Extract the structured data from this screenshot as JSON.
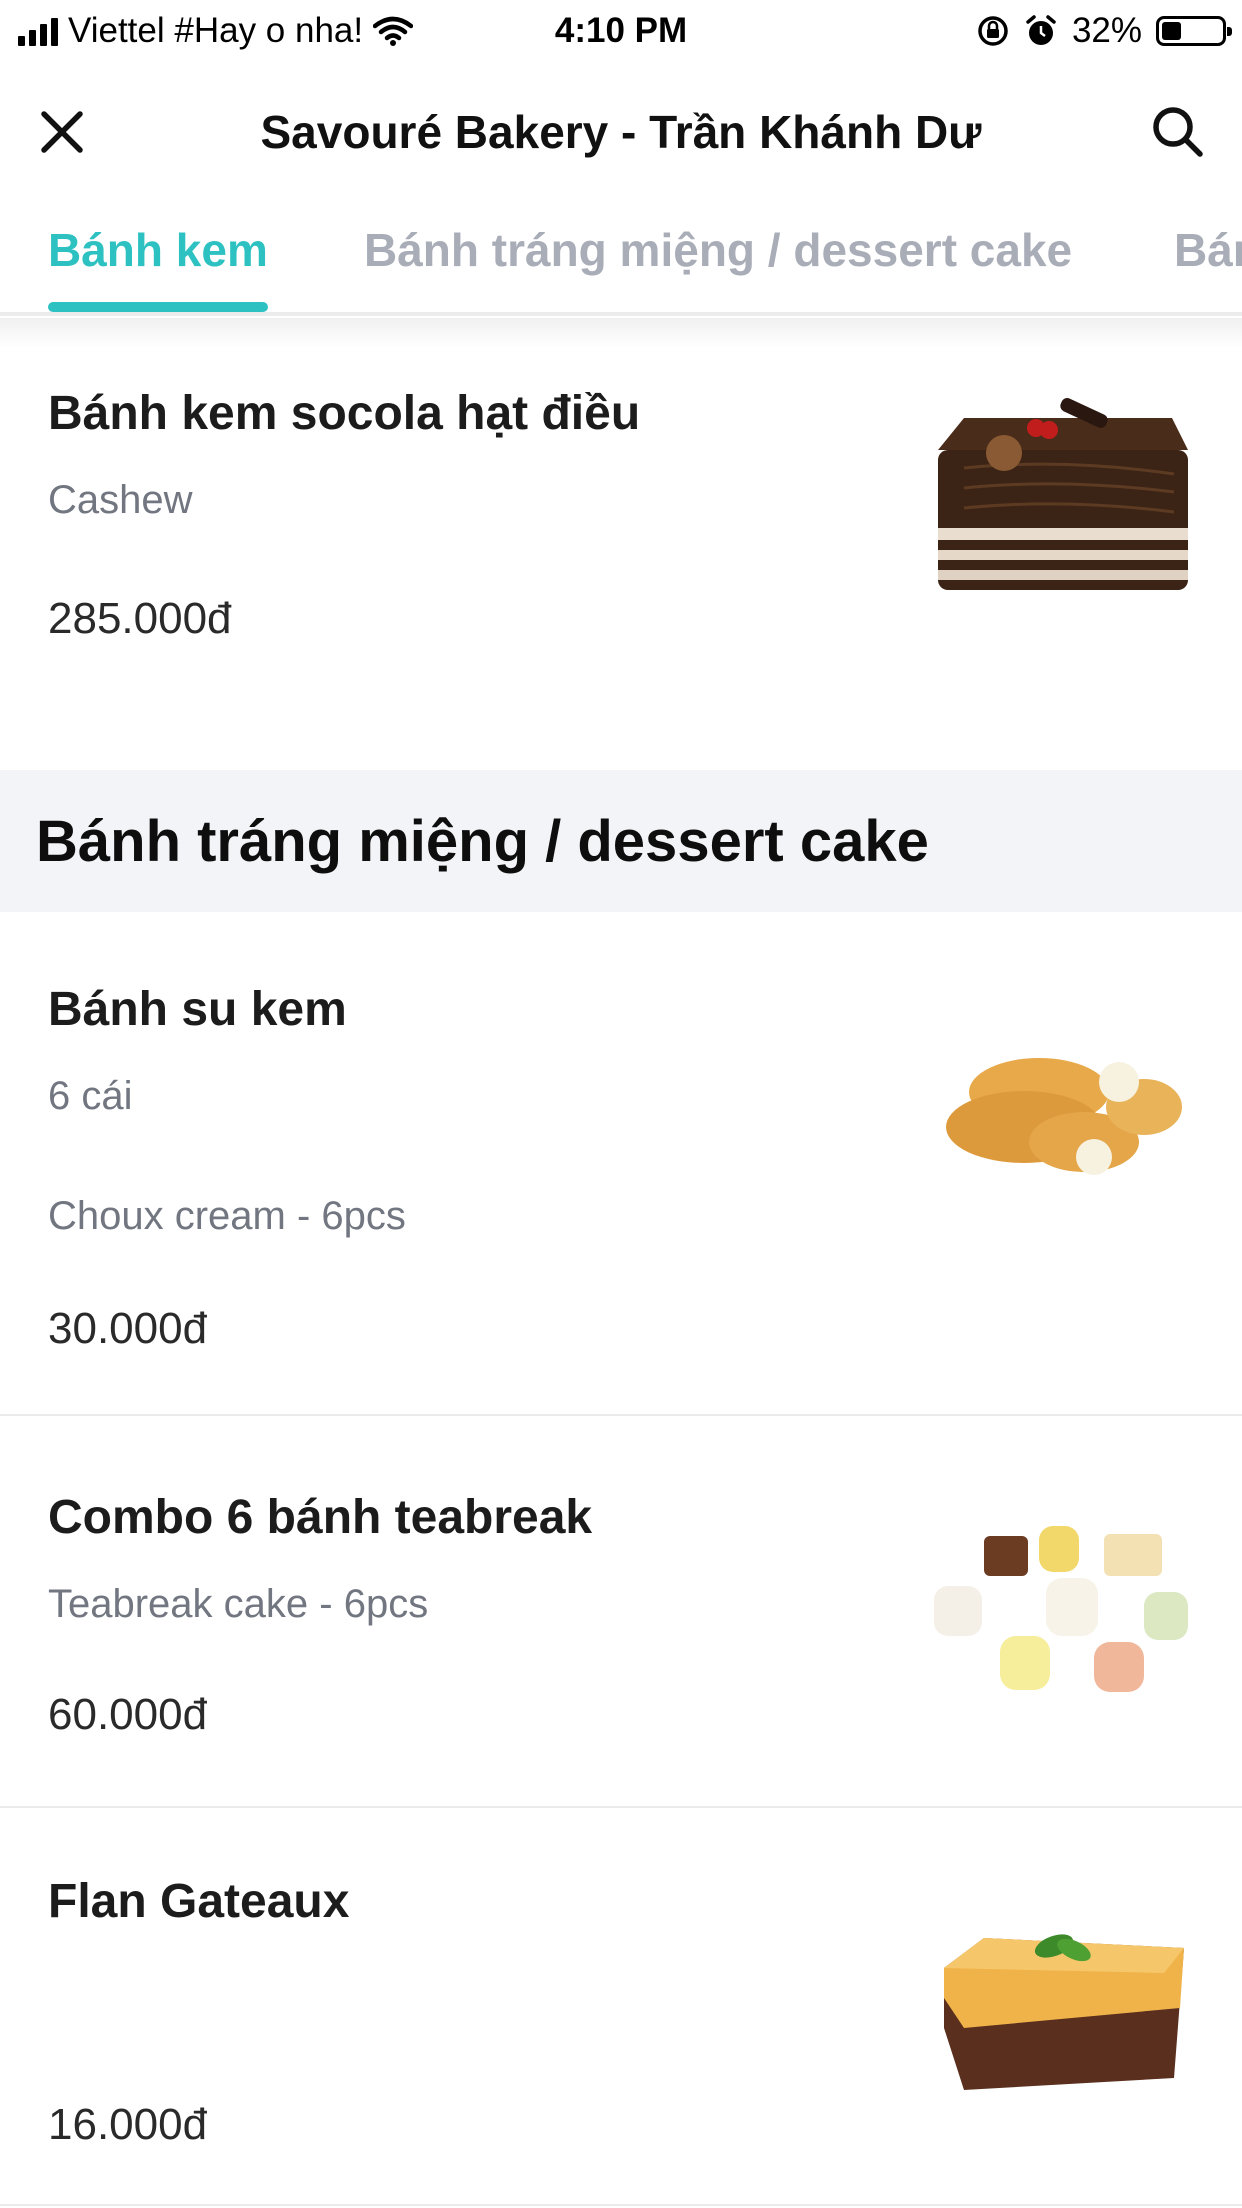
{
  "status_bar": {
    "carrier": "Viettel #Hay o nha!",
    "time": "4:10 PM",
    "battery_percent": "32%",
    "battery_level": 0.32,
    "icons": [
      "signal-icon",
      "wifi-icon",
      "orientation-lock-icon",
      "alarm-icon",
      "battery-icon"
    ]
  },
  "header": {
    "title": "Savouré Bakery - Trần Khánh Dư",
    "close_icon": "close-icon",
    "search_icon": "search-icon"
  },
  "tabs": [
    {
      "label": "Bánh kem",
      "active": true
    },
    {
      "label": "Bánh tráng miệng / dessert cake",
      "active": false
    },
    {
      "label": "Bán",
      "active": false
    }
  ],
  "colors": {
    "accent": "#2ec1c1",
    "inactive_tab": "#a9adb7",
    "section_bg": "#f3f4f7"
  },
  "items_top": [
    {
      "name": "Bánh kem socola hạt điều",
      "desc": "Cashew",
      "price": "285.000đ"
    }
  ],
  "section": {
    "title": "Bánh tráng miệng / dessert cake"
  },
  "items": [
    {
      "name": "Bánh su kem",
      "desc": "6 cái",
      "desc2": "Choux cream - 6pcs",
      "price": "30.000đ"
    },
    {
      "name": "Combo 6 bánh teabreak",
      "desc": "Teabreak cake - 6pcs",
      "price": "60.000đ"
    },
    {
      "name": "Flan Gateaux",
      "price": "16.000đ"
    }
  ]
}
